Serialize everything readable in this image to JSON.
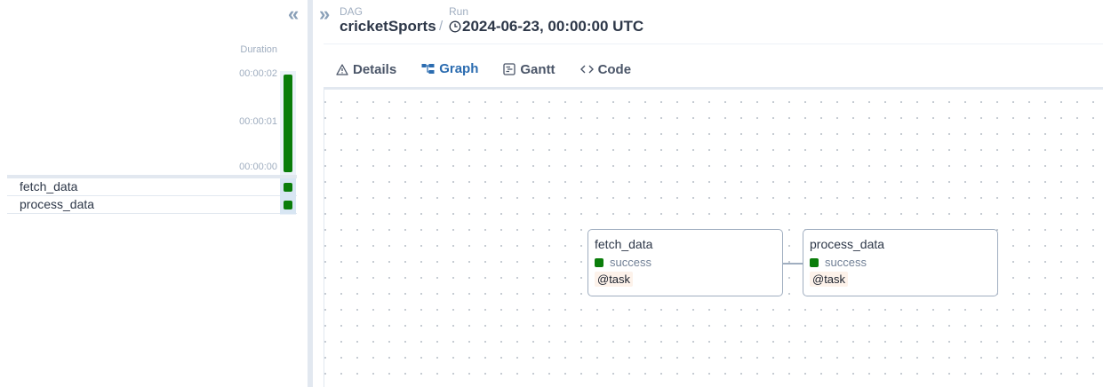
{
  "grid": {
    "collapse_icon": "double-chevron-left-icon",
    "duration_label": "Duration",
    "duration_ticks": [
      "00:00:02",
      "00:00:01",
      "00:00:00"
    ],
    "run_state": "success",
    "tasks": [
      {
        "name": "fetch_data",
        "state": "success"
      },
      {
        "name": "process_data",
        "state": "success"
      }
    ]
  },
  "header": {
    "expand_icon": "double-chevron-right-icon",
    "dag_label": "DAG",
    "dag_name": "cricketSports",
    "separator": "/",
    "run_label": "Run",
    "run_icon": "clock-icon",
    "run_id": "2024-06-23, 00:00:00 UTC"
  },
  "tabs": [
    {
      "label": "Details",
      "icon": "warning-triangle-icon",
      "active": false
    },
    {
      "label": "Graph",
      "icon": "graph-icon",
      "active": true
    },
    {
      "label": "Gantt",
      "icon": "gantt-icon",
      "active": false
    },
    {
      "label": "Code",
      "icon": "code-icon",
      "active": false
    }
  ],
  "graph": {
    "nodes": [
      {
        "name": "fetch_data",
        "state": "success",
        "operator": "@task"
      },
      {
        "name": "process_data",
        "state": "success",
        "operator": "@task"
      }
    ],
    "edges": [
      [
        "fetch_data",
        "process_data"
      ]
    ]
  },
  "colors": {
    "success": "#0a7d0a",
    "accent": "#2b6cb0"
  }
}
